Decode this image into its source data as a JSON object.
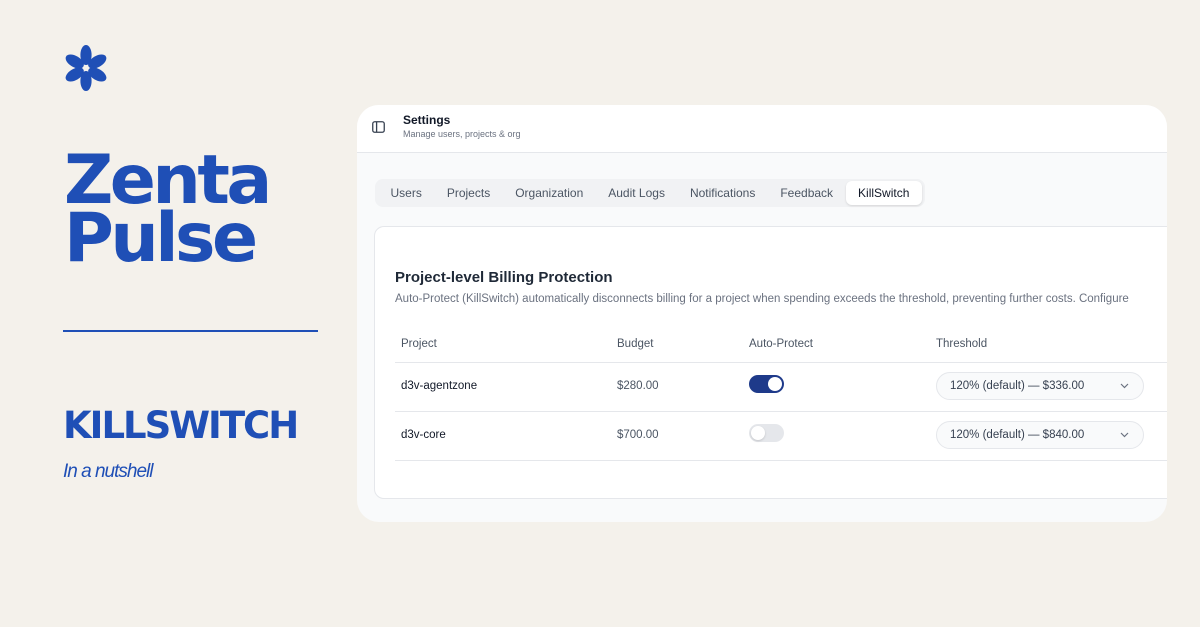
{
  "brand": {
    "name_line1": "Zenta",
    "name_line2": "Pulse",
    "headline": "KILLSWITCH",
    "subline": "In a nutshell",
    "color": "#1f4fb6",
    "logo_icon": "flower-icon"
  },
  "header": {
    "title": "Settings",
    "subtitle": "Manage users, projects & org",
    "sidebar_toggle_icon": "sidebar-toggle-icon"
  },
  "tabs": [
    {
      "label": "Users",
      "active": false
    },
    {
      "label": "Projects",
      "active": false
    },
    {
      "label": "Organization",
      "active": false
    },
    {
      "label": "Audit Logs",
      "active": false
    },
    {
      "label": "Notifications",
      "active": false
    },
    {
      "label": "Feedback",
      "active": false
    },
    {
      "label": "KillSwitch",
      "active": true
    }
  ],
  "section": {
    "title": "Project-level Billing Protection",
    "description": "Auto-Protect (KillSwitch) automatically disconnects billing for a project when spending exceeds the threshold, preventing further costs. Configure"
  },
  "table": {
    "columns": [
      "Project",
      "Budget",
      "Auto-Protect",
      "Threshold"
    ],
    "rows": [
      {
        "project": "d3v-agentzone",
        "budget": "$280.00",
        "auto_protect": true,
        "threshold": "120% (default) — $336.00"
      },
      {
        "project": "d3v-core",
        "budget": "$700.00",
        "auto_protect": false,
        "threshold": "120% (default) — $840.00"
      }
    ]
  },
  "colors": {
    "accent": "#1e3a8a",
    "background": "#f4f1eb"
  }
}
